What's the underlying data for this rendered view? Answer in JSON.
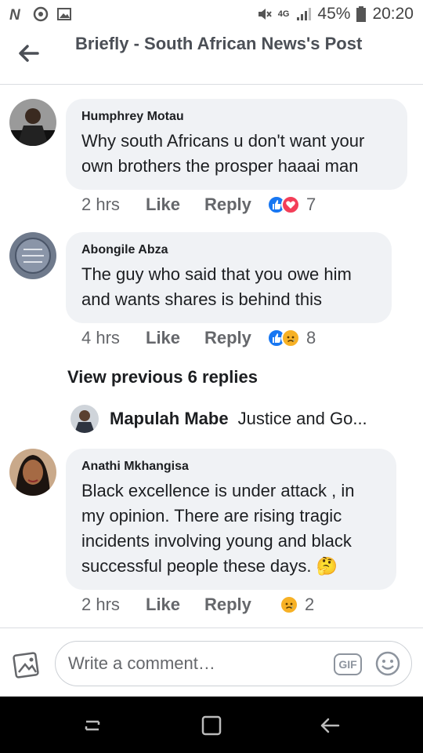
{
  "status_bar": {
    "left_icons": [
      "n-app-icon",
      "chrome-icon",
      "gallery-icon"
    ],
    "network": "4G",
    "battery": "45%",
    "time": "20:20"
  },
  "header": {
    "title": "Briefly - South African News's Post"
  },
  "comments": [
    {
      "author": "Humphrey Motau",
      "text": "Why south Africans u don't want your own brothers the prosper haaai man",
      "time": "2 hrs",
      "like_label": "Like",
      "reply_label": "Reply",
      "reactions": [
        "like",
        "love"
      ],
      "reaction_count": "7"
    },
    {
      "author": "Abongile Abza",
      "text": "The guy who said that you owe him and wants shares is behind this",
      "time": "4 hrs",
      "like_label": "Like",
      "reply_label": "Reply",
      "reactions": [
        "like",
        "sad"
      ],
      "reaction_count": "8"
    },
    {
      "author": "Anathi Mkhangisa",
      "text": "Black excellence is under attack , in my opinion. There are rising tragic incidents involving young and black successful people these days. 🤔",
      "time": "2 hrs",
      "like_label": "Like",
      "reply_label": "Reply",
      "reactions": [
        "sad"
      ],
      "reaction_count": "2"
    }
  ],
  "view_previous": "View previous 6 replies",
  "reply_preview": {
    "author": "Mapulah Mabe",
    "text": "Justice  and Go..."
  },
  "composer": {
    "placeholder": "Write a comment…",
    "gif_label": "GIF"
  },
  "colors": {
    "bubble": "#f0f2f5",
    "like_blue": "#1877f2",
    "love_red": "#f33e58",
    "sad_yellow": "#f7b125",
    "meta_gray": "#65676b"
  }
}
